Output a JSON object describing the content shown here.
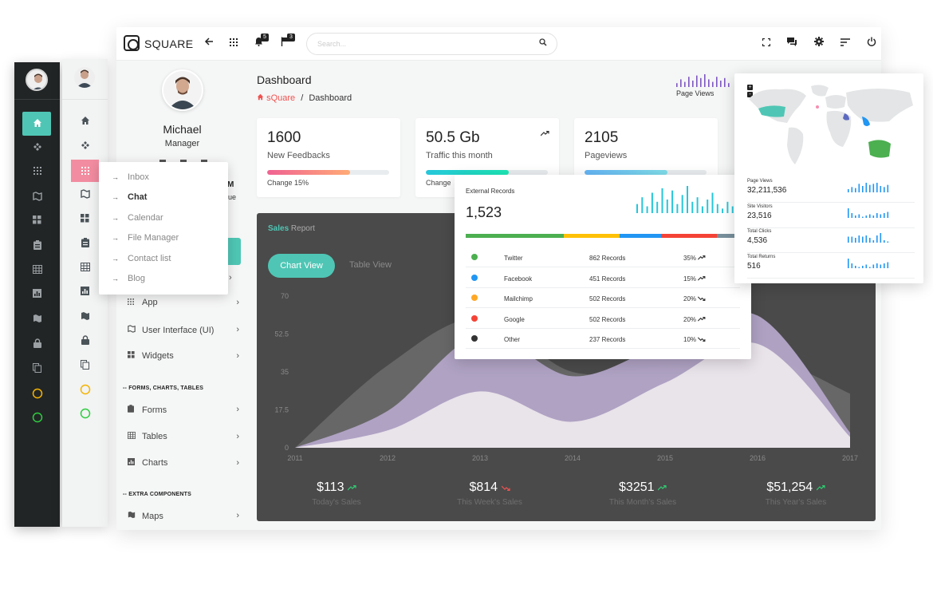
{
  "app": {
    "name": "SQUARE",
    "search_placeholder": "Search..."
  },
  "topbar": {
    "notifications_count": "5",
    "flags_count": "3"
  },
  "profile": {
    "name": "Michael",
    "role": "Manager",
    "partial_initial": "M",
    "partial_text": "ue"
  },
  "submenu": {
    "items": [
      "Inbox",
      "Chat",
      "Calendar",
      "File Manager",
      "Contact list",
      "Blog"
    ],
    "active": "Chat"
  },
  "sidebar": {
    "items": [
      {
        "label": "App"
      },
      {
        "label": "User Interface (UI)"
      },
      {
        "label": "Widgets"
      }
    ],
    "section_forms": "-- FORMS, CHARTS, TABLES",
    "forms_items": [
      {
        "label": "Forms"
      },
      {
        "label": "Tables"
      },
      {
        "label": "Charts"
      }
    ],
    "section_extra": "-- EXTRA COMPONENTS",
    "extra_items": [
      {
        "label": "Maps"
      }
    ]
  },
  "header": {
    "title": "Dashboard",
    "breadcrumb_home": "sQuare",
    "breadcrumb_sep": "/",
    "breadcrumb_current": "Dashboard",
    "page_views_label": "Page Views"
  },
  "cards": [
    {
      "value": "1600",
      "label": "New Feedbacks",
      "change": "Change 15%",
      "progress": 0.68,
      "color_from": "#f06292",
      "color_to": "#ffab76"
    },
    {
      "value": "50.5 Gb",
      "label": "Traffic this month",
      "change": "Change",
      "progress": 0.68,
      "color_from": "#26c6da",
      "color_to": "#1de9b6"
    },
    {
      "value": "2105",
      "label": "Pageviews",
      "change": "",
      "progress": 0.68,
      "color_from": "#64b5f6",
      "color_to": "#80deea"
    }
  ],
  "sales": {
    "title_bold": "Sales",
    "title_rest": " Report",
    "tab_active": "Chart View",
    "tab_inactive": "Table View",
    "totals": [
      {
        "amount": "$113",
        "label": "Today's Sales",
        "trend": "up"
      },
      {
        "amount": "$814",
        "label": "This Week's Sales",
        "trend": "down"
      },
      {
        "amount": "$3251",
        "label": "This Month's Sales",
        "trend": "up"
      },
      {
        "amount": "$51,254",
        "label": "This Year's Sales",
        "trend": "up"
      }
    ]
  },
  "chart_data": {
    "type": "area",
    "x": [
      "2011",
      "2012",
      "2013",
      "2014",
      "2015",
      "2016",
      "2017"
    ],
    "yticks": [
      "70",
      "52.5",
      "35",
      "17.5",
      "0"
    ],
    "ylim": [
      0,
      70
    ],
    "series": [
      {
        "values": [
          0,
          38,
          60,
          35,
          38,
          43,
          25
        ]
      },
      {
        "values": [
          0,
          17,
          52,
          33,
          48,
          61,
          7
        ]
      },
      {
        "values": [
          0,
          8,
          26,
          12,
          30,
          48,
          5
        ]
      }
    ],
    "colors": [
      "#6a6a6a",
      "#b3a5c8",
      "#ece7ec"
    ]
  },
  "external": {
    "title": "External Records",
    "total": "1,523",
    "bar_segments": [
      {
        "color": "#4caf50",
        "share": 0.35
      },
      {
        "color": "#ffc107",
        "share": 0.2
      },
      {
        "color": "#2196f3",
        "share": 0.15
      },
      {
        "color": "#f44336",
        "share": 0.2
      },
      {
        "color": "#78909c",
        "share": 0.1
      }
    ],
    "rows": [
      {
        "name": "Twitter",
        "records": "862 Records",
        "pct": "35%",
        "trend": "up",
        "color": "#4caf50"
      },
      {
        "name": "Facebook",
        "records": "451 Records",
        "pct": "15%",
        "trend": "up",
        "color": "#2196f3"
      },
      {
        "name": "Mailchimp",
        "records": "502 Records",
        "pct": "20%",
        "trend": "down",
        "color": "#ffa726"
      },
      {
        "name": "Google",
        "records": "502 Records",
        "pct": "20%",
        "trend": "up",
        "color": "#f44336"
      },
      {
        "name": "Other",
        "records": "237 Records",
        "pct": "10%",
        "trend": "down",
        "color": "#333333"
      }
    ],
    "sparkline": [
      4,
      7,
      3,
      9,
      5,
      11,
      6,
      10,
      4,
      8,
      12,
      5,
      7,
      3,
      6,
      9,
      4,
      2,
      5,
      3
    ]
  },
  "map": {
    "stats": [
      {
        "label": "Page Views",
        "value": "32,211,536",
        "spark": [
          3,
          5,
          4,
          8,
          6,
          9,
          7,
          8,
          9,
          6,
          5,
          7
        ]
      },
      {
        "label": "Site Visitors",
        "value": "23,516",
        "spark": [
          8,
          4,
          2,
          3,
          1,
          2,
          3,
          2,
          4,
          3,
          4,
          5
        ]
      },
      {
        "label": "Total Clicks",
        "value": "4,536",
        "spark": [
          5,
          5,
          4,
          6,
          5,
          6,
          4,
          2,
          6,
          8,
          2,
          1
        ]
      },
      {
        "label": "Total Returns",
        "value": "516",
        "spark": [
          8,
          4,
          2,
          1,
          2,
          3,
          1,
          3,
          4,
          3,
          4,
          5
        ]
      }
    ],
    "zoom_in": "+",
    "zoom_out": "-"
  },
  "page_views_spark": [
    3,
    6,
    4,
    8,
    5,
    9,
    7,
    10,
    6,
    4,
    8,
    5,
    7,
    3
  ],
  "colors": {
    "accent": "#4fc6b5",
    "active_rail": "#4fc6b5",
    "submenu_active": "#f28ca0"
  }
}
